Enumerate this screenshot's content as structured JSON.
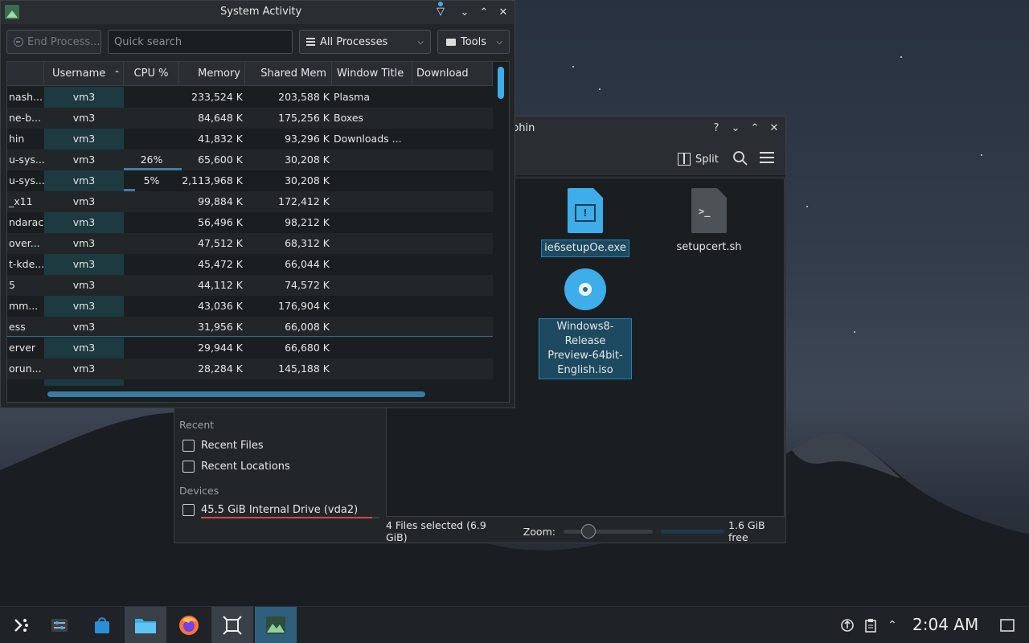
{
  "colors": {
    "accent": "#3daee9",
    "window_bg": "#232629",
    "titlebar_bg": "#2a2e32",
    "selection": "#1d4a60",
    "drive_bar": "#da4453",
    "taskbar_bg": "#1f2226"
  },
  "system_activity": {
    "title": "System Activity",
    "toolbar": {
      "kill_label": "End Process...",
      "search_placeholder": "Quick search",
      "filter_label": "All Processes",
      "tools_label": "Tools"
    },
    "columns": [
      "",
      "Username",
      "CPU %",
      "Memory",
      "Shared Mem",
      "Window Title",
      "Download"
    ],
    "sort_column": "Username",
    "rows": [
      {
        "name": "nash...",
        "user": "vm3",
        "cpu": "",
        "memory": "233,524 K",
        "shared": "203,588 K",
        "window": "Plasma"
      },
      {
        "name": "ne-b...",
        "user": "vm3",
        "cpu": "",
        "memory": "84,648 K",
        "shared": "175,256 K",
        "window": "Boxes"
      },
      {
        "name": "hin",
        "user": "vm3",
        "cpu": "",
        "memory": "41,832 K",
        "shared": "93,296 K",
        "window": "Downloads ..."
      },
      {
        "name": "u-sys...",
        "user": "vm3",
        "cpu": "26%",
        "memory": "65,600 K",
        "shared": "30,208 K",
        "window": ""
      },
      {
        "name": "u-sys...",
        "user": "vm3",
        "cpu": "5%",
        "memory": "2,113,968 K",
        "shared": "30,208 K",
        "window": ""
      },
      {
        "name": "_x11",
        "user": "vm3",
        "cpu": "",
        "memory": "99,884 K",
        "shared": "172,412 K",
        "window": ""
      },
      {
        "name": "ndarac",
        "user": "vm3",
        "cpu": "",
        "memory": "56,496 K",
        "shared": "98,212 K",
        "window": ""
      },
      {
        "name": "over...",
        "user": "vm3",
        "cpu": "",
        "memory": "47,512 K",
        "shared": "68,312 K",
        "window": ""
      },
      {
        "name": "t-kde...",
        "user": "vm3",
        "cpu": "",
        "memory": "45,472 K",
        "shared": "66,044 K",
        "window": ""
      },
      {
        "name": "5",
        "user": "vm3",
        "cpu": "",
        "memory": "44,112 K",
        "shared": "74,572 K",
        "window": ""
      },
      {
        "name": "mm...",
        "user": "vm3",
        "cpu": "",
        "memory": "43,036 K",
        "shared": "176,904 K",
        "window": ""
      },
      {
        "name": "ess",
        "user": "vm3",
        "cpu": "",
        "memory": "31,956 K",
        "shared": "66,008 K",
        "window": ""
      },
      {
        "name": "erver",
        "user": "vm3",
        "cpu": "",
        "memory": "29,944 K",
        "shared": "66,680 K",
        "window": ""
      },
      {
        "name": "orun...",
        "user": "vm3",
        "cpu": "",
        "memory": "28,284 K",
        "shared": "145,188 K",
        "window": ""
      }
    ]
  },
  "dolphin": {
    "title": "phin",
    "toolbar": {
      "split_label": "Split"
    },
    "places": {
      "recent_heading": "Recent",
      "recent_files": "Recent Files",
      "recent_locations": "Recent Locations",
      "devices_heading": "Devices",
      "drive_label": "45.5 GiB Internal Drive (vda2)",
      "drive_usage_fraction": 0.96
    },
    "files": [
      {
        "name": "ie6setupOe.exe",
        "kind": "exe",
        "selected": true
      },
      {
        "name": "setupcert.sh",
        "kind": "shell-script",
        "selected": false
      },
      {
        "name": "Windows8-Release Preview-64bit-English.iso",
        "name_lines": [
          "Windows8-Release",
          "Preview-64bit-",
          "English.iso"
        ],
        "kind": "disc-image",
        "selected": true
      }
    ],
    "status": {
      "selection_text": "4 Files selected (6.9 GiB)",
      "zoom_label": "Zoom:",
      "free_text": "1.6 GiB free"
    }
  },
  "taskbar": {
    "apps": [
      "application-launcher",
      "system-settings",
      "discover",
      "dolphin",
      "firefox",
      "screenshot-tool",
      "system-activity"
    ],
    "clock": "2:04 AM"
  }
}
